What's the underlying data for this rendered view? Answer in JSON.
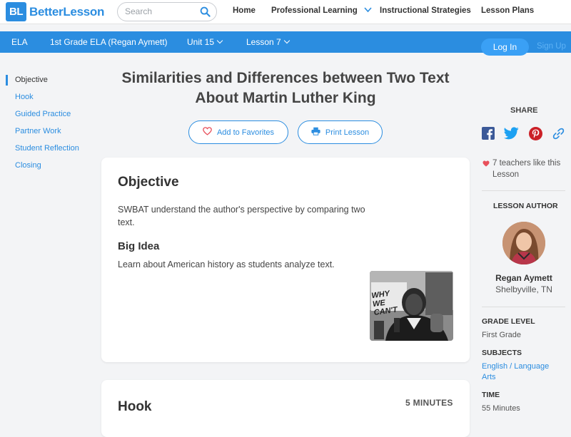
{
  "brand": {
    "logo_mark": "BL",
    "name": "BetterLesson",
    "color": "#2b8de0"
  },
  "search": {
    "placeholder": "Search",
    "icon": "search-icon"
  },
  "topnav": {
    "home": "Home",
    "professional_learning": "Professional Learning",
    "instructional_strategies": "Instructional Strategies",
    "lesson_plans": "Lesson Plans"
  },
  "breadcrumb": {
    "subject": "ELA",
    "course": "1st Grade ELA (Regan Aymett)",
    "unit": "Unit 15",
    "lesson": "Lesson 7"
  },
  "auth": {
    "login": "Log In",
    "signup": "Sign Up"
  },
  "sidenav": {
    "items": [
      {
        "label": "Objective"
      },
      {
        "label": "Hook"
      },
      {
        "label": "Guided Practice"
      },
      {
        "label": "Partner Work"
      },
      {
        "label": "Student Reflection"
      },
      {
        "label": "Closing"
      }
    ]
  },
  "lesson": {
    "title_line1": "Similarities and Differences between Two Text",
    "title_line2": "About Martin Luther King",
    "add_favorites": "Add to Favorites",
    "print": "Print Lesson"
  },
  "objective": {
    "heading": "Objective",
    "text_line1": "SWBAT understand the author's perspective by comparing two",
    "text_line2": "text.",
    "big_idea_heading": "Big Idea",
    "big_idea_text": "Learn about American history as students analyze text.",
    "photo_sign_text": "WHY WE CAN'T"
  },
  "hook": {
    "heading": "Hook",
    "duration": "5 MINUTES"
  },
  "sidebar": {
    "share_label": "SHARE",
    "likes_line1": "7 teachers like this",
    "likes_line2": "Lesson",
    "author_label": "LESSON AUTHOR",
    "author_name": "Regan Aymett",
    "author_location": "Shelbyville, TN",
    "grade_label": "GRADE LEVEL",
    "grade_value": "First Grade",
    "subjects_label": "SUBJECTS",
    "subjects_line1": "English / Language",
    "subjects_line2": "Arts",
    "time_label": "TIME",
    "time_value": "55 Minutes"
  },
  "colors": {
    "accent": "#2b8de0",
    "heart": "#e8505b",
    "facebook": "#3b5998",
    "twitter": "#1da1f2",
    "pinterest": "#cb2027"
  }
}
